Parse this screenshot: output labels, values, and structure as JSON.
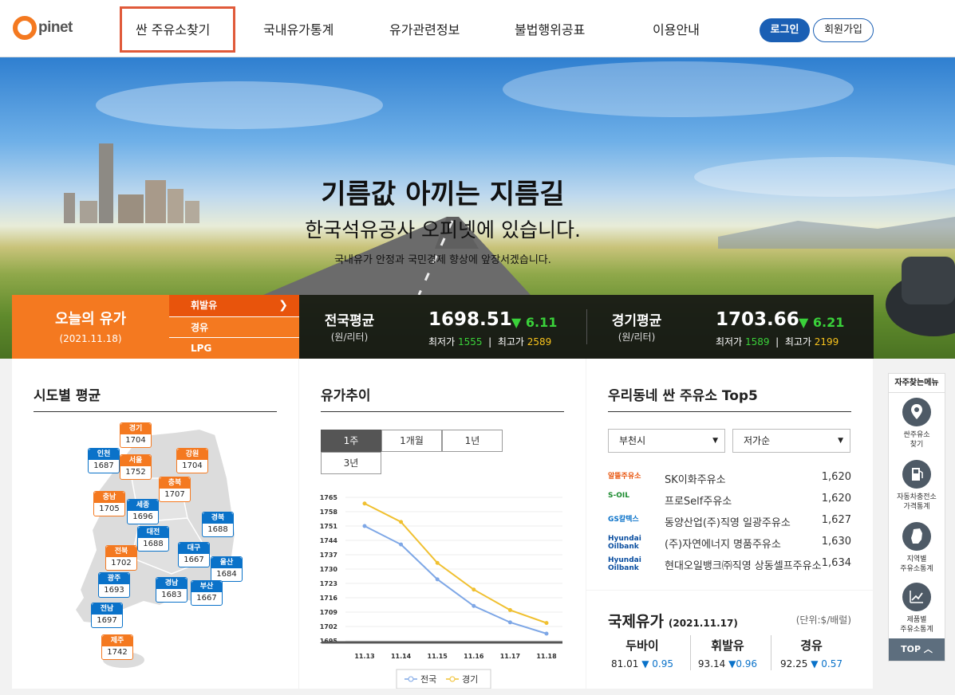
{
  "header": {
    "logo_rest": "pinet",
    "nav": [
      "싼 주유소찾기",
      "국내유가통계",
      "유가관련정보",
      "불법행위공표",
      "이용안내"
    ],
    "login": "로그인",
    "join": "회원가입"
  },
  "hero": {
    "title": "기름값 아끼는 지름길",
    "subtitle": "한국석유공사 오피넷에 있습니다.",
    "desc": "국내유가 안정과 국민경제 향상에 앞장서겠습니다."
  },
  "today": {
    "title": "오늘의 유가",
    "date": "(2021.11.18)",
    "fuels": [
      "휘발유",
      "경유",
      "LPG"
    ],
    "national": {
      "label": "전국평균",
      "unit": "(원/리터)",
      "price": "1698.51",
      "change": "▼ 6.11",
      "min_label": "최저가",
      "min": "1555",
      "max_label": "최고가",
      "max": "2589"
    },
    "gyeonggi": {
      "label": "경기평균",
      "unit": "(원/리터)",
      "price": "1703.66",
      "change": "▼ 6.21",
      "min_label": "최저가",
      "min": "1589",
      "max_label": "최고가",
      "max": "2199"
    }
  },
  "regions": {
    "title": "시도별 평균",
    "items": [
      {
        "name": "경기",
        "value": "1704",
        "color": "o"
      },
      {
        "name": "인천",
        "value": "1687",
        "color": "b"
      },
      {
        "name": "서울",
        "value": "1752",
        "color": "o"
      },
      {
        "name": "강원",
        "value": "1704",
        "color": "o"
      },
      {
        "name": "충북",
        "value": "1707",
        "color": "o"
      },
      {
        "name": "충남",
        "value": "1705",
        "color": "o"
      },
      {
        "name": "세종",
        "value": "1696",
        "color": "b"
      },
      {
        "name": "경북",
        "value": "1688",
        "color": "b"
      },
      {
        "name": "대전",
        "value": "1688",
        "color": "b"
      },
      {
        "name": "전북",
        "value": "1702",
        "color": "o"
      },
      {
        "name": "대구",
        "value": "1667",
        "color": "b"
      },
      {
        "name": "울산",
        "value": "1684",
        "color": "b"
      },
      {
        "name": "광주",
        "value": "1693",
        "color": "b"
      },
      {
        "name": "경남",
        "value": "1683",
        "color": "b"
      },
      {
        "name": "부산",
        "value": "1667",
        "color": "b"
      },
      {
        "name": "전남",
        "value": "1697",
        "color": "b"
      },
      {
        "name": "제주",
        "value": "1742",
        "color": "o"
      }
    ]
  },
  "trend": {
    "title": "유가추이",
    "tabs": [
      "1주",
      "1개월",
      "1년",
      "3년"
    ]
  },
  "chart_data": {
    "type": "line",
    "categories": [
      "11.13",
      "11.14",
      "11.15",
      "11.16",
      "11.17",
      "11.18"
    ],
    "series": [
      {
        "name": "전국",
        "color": "#7ea7e6",
        "values": [
          1751,
          1742,
          1725,
          1712,
          1704,
          1698.5
        ]
      },
      {
        "name": "경기",
        "color": "#f0c030",
        "values": [
          1762,
          1753,
          1733,
          1720,
          1710,
          1703.7
        ]
      }
    ],
    "yticks": [
      "1765",
      "1758",
      "1751",
      "1744",
      "1737",
      "1730",
      "1723",
      "1716",
      "1709",
      "1702",
      "1695"
    ],
    "ylim": [
      1695,
      1765
    ]
  },
  "stations": {
    "title": "우리동네 싼 주유소 Top5",
    "region_select": "부천시",
    "sort_select": "저가순",
    "list": [
      {
        "brand": "알뜰주유소",
        "brand_color": "#e8540c",
        "name": "SK이화주유소",
        "price": "1,620"
      },
      {
        "brand": "S-OIL",
        "brand_color": "#1a8a2e",
        "name": "프로Self주유소",
        "price": "1,620"
      },
      {
        "brand": "GS칼텍스",
        "brand_color": "#0a72c9",
        "name": "동양산업(주)직영 일광주유소",
        "price": "1,627"
      },
      {
        "brand": "Hyundai Oilbank",
        "brand_color": "#0a4ea0",
        "name": "(주)자연에너지 명품주유소",
        "price": "1,630"
      },
      {
        "brand": "Hyundai Oilbank",
        "brand_color": "#0a4ea0",
        "name": "현대오일뱅크㈜직영 상동셀프주유소",
        "price": "1,634"
      }
    ]
  },
  "intl": {
    "title": "국제유가",
    "date": "(2021.11.17)",
    "unit": "(단위:$/배럴)",
    "items": [
      {
        "name": "두바이",
        "value": "81.01",
        "change": "▼ 0.95"
      },
      {
        "name": "휘발유",
        "value": "93.14",
        "change": "▼0.96"
      },
      {
        "name": "경유",
        "value": "92.25",
        "change": "▼ 0.57"
      }
    ]
  },
  "quick_menu": {
    "title": "자주찾는메뉴",
    "items": [
      {
        "line1": "싼주유소",
        "line2": "찾기"
      },
      {
        "line1": "자동차충전소",
        "line2": "가격통계"
      },
      {
        "line1": "지역별",
        "line2": "주유소통계"
      },
      {
        "line1": "제품별",
        "line2": "주유소통계"
      }
    ],
    "top": "TOP"
  }
}
